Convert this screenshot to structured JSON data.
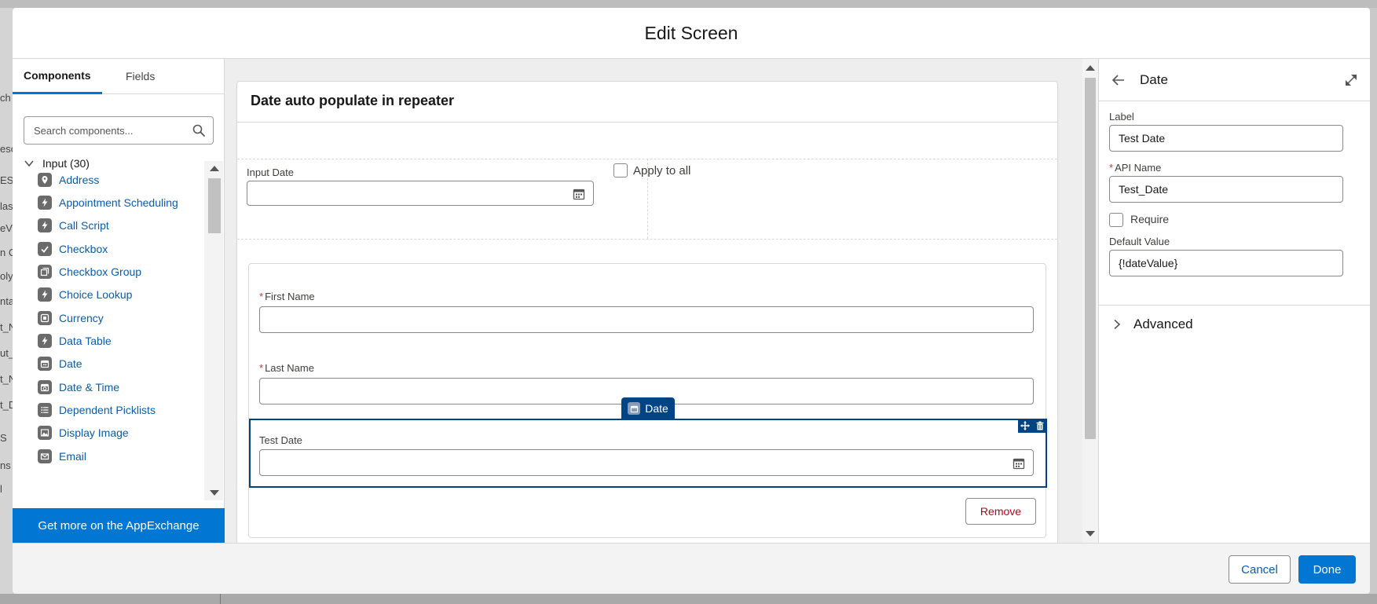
{
  "background": {
    "left_fragments": [
      "ch",
      "eso",
      "ES",
      "las",
      "eV",
      "n C",
      "oly",
      "nta",
      "t_N",
      "ut_",
      "t_N",
      "t_D",
      "S",
      "ns",
      "l"
    ]
  },
  "modal": {
    "title": "Edit Screen"
  },
  "left_panel": {
    "tabs": [
      {
        "label": "Components",
        "active": true
      },
      {
        "label": "Fields",
        "active": false
      }
    ],
    "search": {
      "placeholder": "Search components...",
      "value": ""
    },
    "section": {
      "label": "Input (30)"
    },
    "components": [
      {
        "label": "Address",
        "icon": "map-pin-icon"
      },
      {
        "label": "Appointment Scheduling",
        "icon": "lightning-icon"
      },
      {
        "label": "Call Script",
        "icon": "lightning-icon"
      },
      {
        "label": "Checkbox",
        "icon": "checkmark-icon"
      },
      {
        "label": "Checkbox Group",
        "icon": "checkbox-group-icon"
      },
      {
        "label": "Choice Lookup",
        "icon": "lightning-icon"
      },
      {
        "label": "Currency",
        "icon": "currency-icon"
      },
      {
        "label": "Data Table",
        "icon": "lightning-icon"
      },
      {
        "label": "Date",
        "icon": "calendar-icon"
      },
      {
        "label": "Date & Time",
        "icon": "calendar-clock-icon"
      },
      {
        "label": "Dependent Picklists",
        "icon": "list-icon"
      },
      {
        "label": "Display Image",
        "icon": "image-icon"
      },
      {
        "label": "Email",
        "icon": "envelope-icon"
      }
    ],
    "appexchange": "Get more on the AppExchange"
  },
  "canvas": {
    "card_title": "Date auto populate in repeater",
    "input_date": {
      "label": "Input Date",
      "value": ""
    },
    "apply_to_all": {
      "label": "Apply to all",
      "checked": false
    },
    "repeater": {
      "first_name": {
        "label": "First Name",
        "required": "*",
        "value": ""
      },
      "last_name": {
        "label": "Last Name",
        "required": "*",
        "value": ""
      },
      "selected_pill": "Date",
      "test_date": {
        "label": "Test Date",
        "value": ""
      },
      "remove_label": "Remove"
    }
  },
  "right_panel": {
    "title": "Date",
    "label_field": {
      "label": "Label",
      "value": "Test Date"
    },
    "api_name_field": {
      "label": "API Name",
      "required": "*",
      "value": "Test_Date"
    },
    "require": {
      "label": "Require",
      "checked": false
    },
    "default_value": {
      "label": "Default Value",
      "value": "{!dateValue}"
    },
    "advanced": "Advanced"
  },
  "footer": {
    "cancel": "Cancel",
    "done": "Done"
  },
  "colors": {
    "brand": "#0176d3",
    "selected_border": "#014486",
    "link": "#0b5cab",
    "required": "#c23934"
  }
}
